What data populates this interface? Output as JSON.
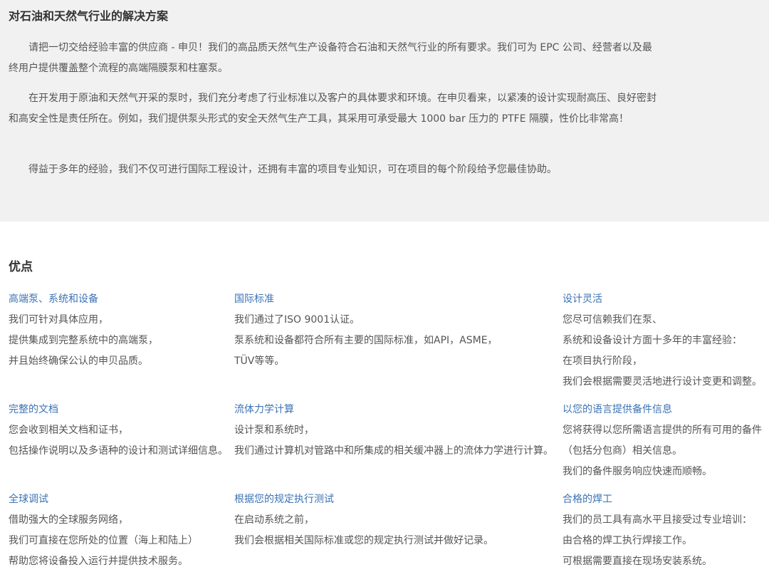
{
  "intro": {
    "title": "对石油和天然气行业的解决方案",
    "paragraphs": [
      "请把一切交给经验丰富的供应商 - 申贝！我们的高品质天然气生产设备符合石油和天然气行业的所有要求。我们可为 EPC 公司、经营者以及最终用户提供覆盖整个流程的高端隔膜泵和柱塞泵。",
      "在开发用于原油和天然气开采的泵时，我们充分考虑了行业标准以及客户的具体要求和环境。在申贝看来，以紧凑的设计实现耐高压、良好密封和高安全性是责任所在。例如，我们提供泵头形式的安全天然气生产工具，其采用可承受最大 1000 bar 压力的 PTFE 隔膜，性价比非常高！",
      "得益于多年的经验，我们不仅可进行国际工程设计，还拥有丰富的项目专业知识，可在项目的每个阶段给予您最佳协助。"
    ]
  },
  "advantages": {
    "title": "优点",
    "items": [
      {
        "title": "高端泵、系统和设备",
        "lines": [
          "我们可针对具体应用，",
          "提供集成到完整系统中的高端泵，",
          "并且始终确保公认的申贝品质。"
        ]
      },
      {
        "title": "国际标准",
        "lines": [
          "我们通过了ISO 9001认证。",
          "泵系统和设备都符合所有主要的国际标准，如API，ASME，",
          "TÜV等等。"
        ]
      },
      {
        "title": "设计灵活",
        "lines": [
          "您尽可信赖我们在泵、",
          "系统和设备设计方面十多年的丰富经验：",
          "在项目执行阶段，",
          "我们会根据需要灵活地进行设计变更和调整。"
        ]
      },
      {
        "title": "完整的文档",
        "lines": [
          "您会收到相关文档和证书，",
          "包括操作说明以及多语种的设计和测试详细信息。"
        ]
      },
      {
        "title": "流体力学计算",
        "lines": [
          "设计泵和系统时，",
          "我们通过计算机对管路中和所集成的相关缓冲器上的流体力学进行计算。"
        ]
      },
      {
        "title": "以您的语言提供备件信息",
        "lines": [
          "您将获得以您所需语言提供的所有可用的备件",
          "（包括分包商）相关信息。",
          "我们的备件服务响应快速而顺畅。"
        ]
      },
      {
        "title": "全球调试",
        "lines": [
          "借助强大的全球服务网络，",
          "我们可直接在您所处的位置（海上和陆上）",
          "帮助您将设备投入运行并提供技术服务。"
        ]
      },
      {
        "title": "根据您的规定执行测试",
        "lines": [
          "在启动系统之前，",
          "我们会根据相关国际标准或您的规定执行测试并做好记录。"
        ]
      },
      {
        "title": "合格的焊工",
        "lines": [
          "我们的员工具有高水平且接受过专业培训：",
          "由合格的焊工执行焊接工作。",
          "可根据需要直接在现场安装系统。"
        ]
      }
    ]
  },
  "colors": {
    "intro_background": "#f1f1f1",
    "feature_title": "#3c73b4",
    "body_text": "#555555",
    "heading_text": "#333333"
  }
}
